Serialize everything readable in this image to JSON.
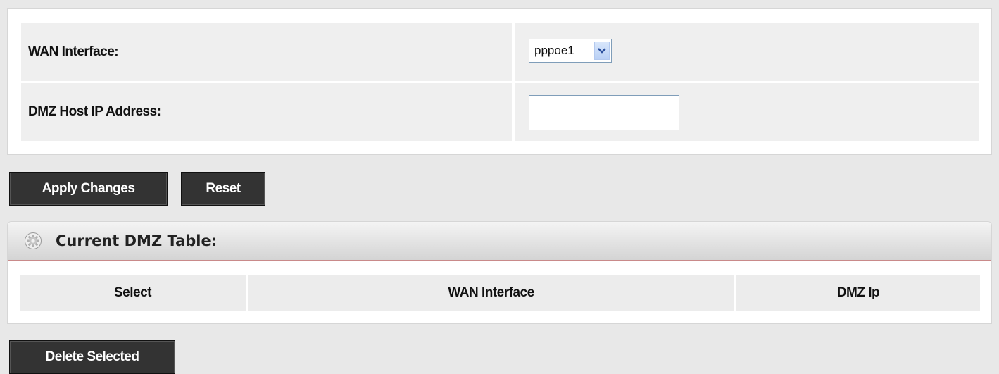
{
  "form": {
    "wan_interface_label": "WAN Interface:",
    "wan_interface_value": "pppoe1",
    "dmz_host_label": "DMZ Host IP Address:",
    "dmz_host_value": ""
  },
  "buttons": {
    "apply": "Apply Changes",
    "reset": "Reset",
    "delete": "Delete Selected"
  },
  "table": {
    "title": "Current DMZ Table:",
    "icon": "gear-icon",
    "columns": [
      "Select",
      "WAN Interface",
      "DMZ Ip"
    ],
    "rows": []
  },
  "colors": {
    "button_bg": "#333333",
    "header_underline": "#c98a8a"
  }
}
